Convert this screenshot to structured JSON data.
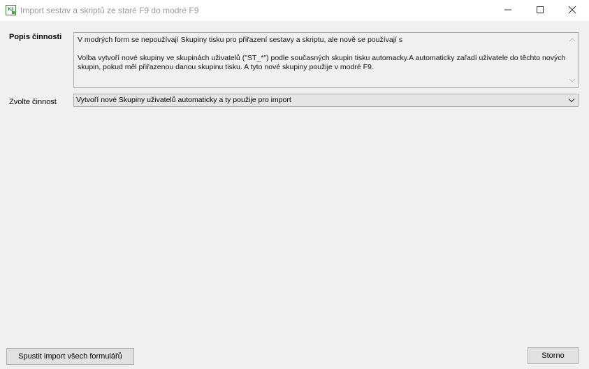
{
  "window": {
    "title": "Import sestav a skriptů ze staré F9 do modré F9",
    "icon_text": "K2"
  },
  "description": {
    "label": "Popis činnosti",
    "text": "V modrých form se nepoužívají Skupiny tisku pro přiřazení sestavy a skriptu, ale nově se používají s\n\nVolba vytvoří nové skupiny ve skupinách uživatelů (\"ST_*\") podle současných skupin tisku automacky.A automaticky zařadí uživatele do těchto nových skupin, pokud měl přiřazenou danou skupinu tisku. A tyto nové skupiny použije v modré F9."
  },
  "activity": {
    "label": "Zvolte činnost",
    "selected": "Vytvoří nové Skupiny uživatelů automaticky a ty použije pro import"
  },
  "buttons": {
    "run_import": "Spustit import všech formulářů",
    "cancel": "Storno"
  }
}
